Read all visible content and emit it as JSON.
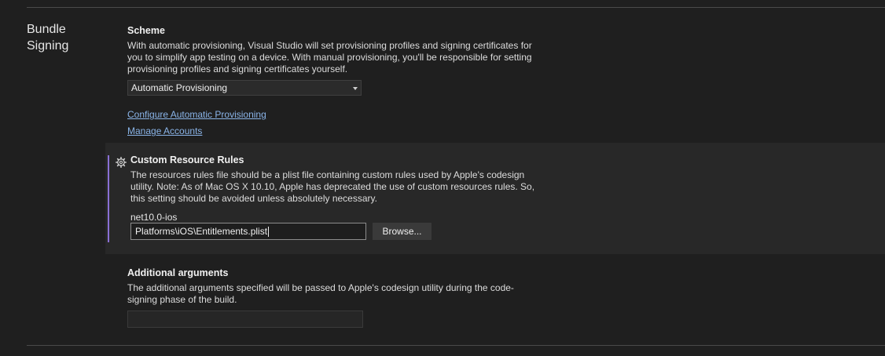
{
  "section": {
    "title_line1": "Bundle",
    "title_line2": "Signing"
  },
  "scheme": {
    "title": "Scheme",
    "description": "With automatic provisioning, Visual Studio will set provisioning profiles and signing certificates for you to simplify app testing on a device. With manual provisioning, you'll be responsible for setting provisioning profiles and signing certificates yourself.",
    "selected": "Automatic Provisioning",
    "links": {
      "configure": "Configure Automatic Provisioning",
      "manage": "Manage Accounts"
    }
  },
  "custom_resource_rules": {
    "title": "Custom Resource Rules",
    "description": "The resources rules file should be a plist file containing custom rules used by Apple's codesign utility. Note: As of Mac OS X 10.10, Apple has deprecated the use of custom resources rules. So, this setting should be avoided unless absolutely necessary.",
    "target_label": "net10.0-ios",
    "value": "Platforms\\iOS\\Entitlements.plist",
    "browse_label": "Browse...",
    "accent_color": "#8a6fd6",
    "icon": "gear-icon"
  },
  "additional_arguments": {
    "title": "Additional arguments",
    "description": "The additional arguments specified will be passed to Apple's codesign utility during the code-signing phase of the build.",
    "value": ""
  },
  "colors": {
    "background": "#1f1f1f",
    "highlight_background": "#282828",
    "link": "#8ab4e8"
  }
}
